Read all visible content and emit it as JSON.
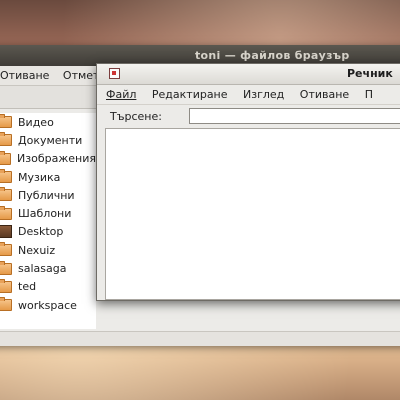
{
  "file_browser": {
    "title": "toni — файлов браузър",
    "menu": [
      "Отиване",
      "Отметки"
    ],
    "places": [
      {
        "label": "Видео",
        "icon": "folder-icon"
      },
      {
        "label": "Документи",
        "icon": "folder-icon"
      },
      {
        "label": "Изображения",
        "icon": "folder-icon"
      },
      {
        "label": "Музика",
        "icon": "folder-icon"
      },
      {
        "label": "Публични",
        "icon": "folder-icon"
      },
      {
        "label": "Шаблони",
        "icon": "folder-icon"
      },
      {
        "label": "Desktop",
        "icon": "desktop-icon"
      },
      {
        "label": "Nexuiz",
        "icon": "folder-icon"
      },
      {
        "label": "salasaga",
        "icon": "folder-icon"
      },
      {
        "label": "ted",
        "icon": "folder-icon"
      },
      {
        "label": "workspace",
        "icon": "folder-icon"
      }
    ]
  },
  "dictionary": {
    "title": "Речник",
    "menu": {
      "file": "Файл",
      "edit": "Редактиране",
      "view": "Изглед",
      "go": "Отиване",
      "help": "П"
    },
    "search_label": "Търсене:",
    "search_value": ""
  }
}
